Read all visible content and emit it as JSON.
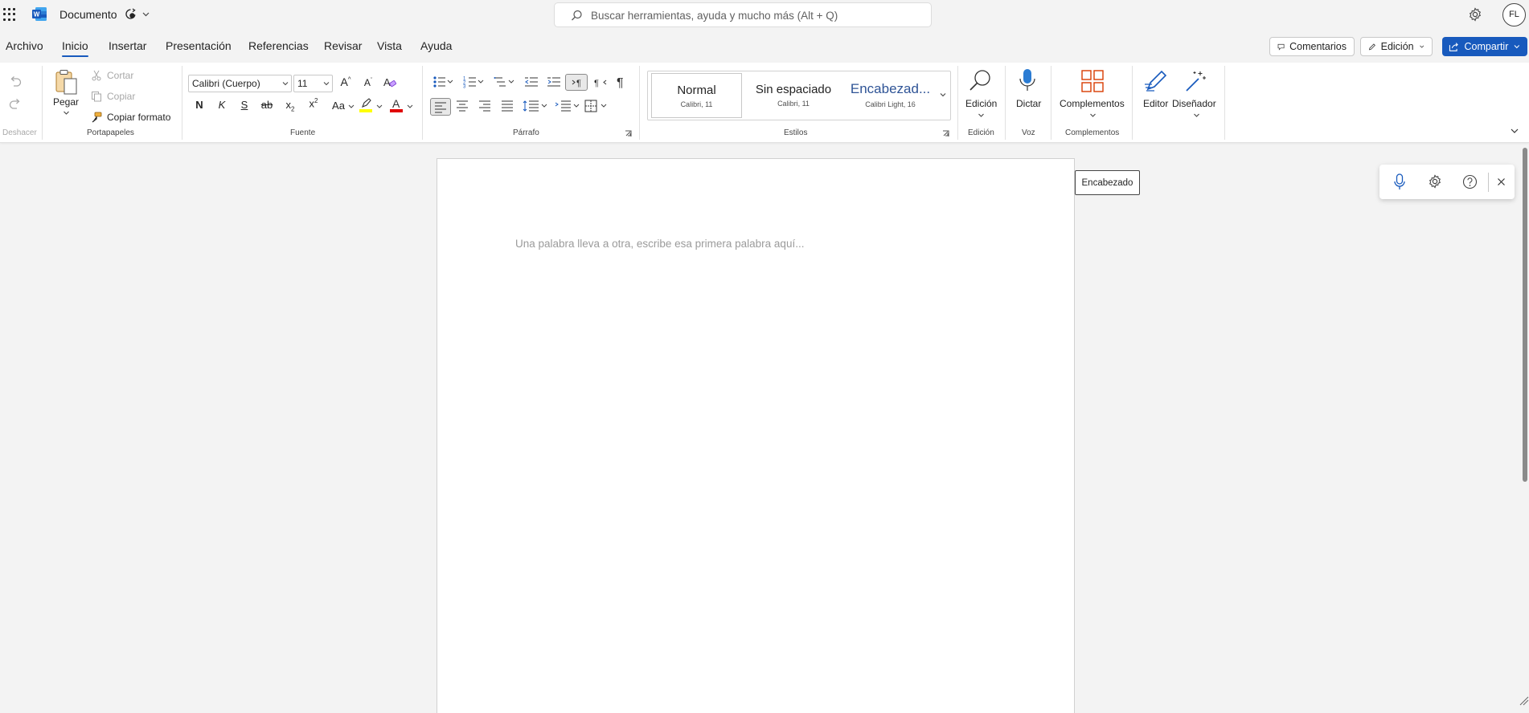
{
  "app": {
    "doc_name": "Documento",
    "search_placeholder": "Buscar herramientas, ayuda y mucho más (Alt + Q)",
    "avatar_initials": "FL"
  },
  "menu": {
    "tabs": [
      "Archivo",
      "Inicio",
      "Insertar",
      "Presentación",
      "Referencias",
      "Revisar",
      "Vista",
      "Ayuda"
    ],
    "active": "Inicio",
    "comments_label": "Comentarios",
    "editing_label": "Edición",
    "share_label": "Compartir"
  },
  "ribbon": {
    "undo_group_label": "Deshacer",
    "clipboard": {
      "paste_label": "Pegar",
      "cut_label": "Cortar",
      "copy_label": "Copiar",
      "format_painter_label": "Copiar formato",
      "group_label": "Portapapeles"
    },
    "font": {
      "font_name": "Calibri (Cuerpo)",
      "font_size": "11",
      "bold": "N",
      "italic": "K",
      "underline": "S",
      "strike": "ab",
      "change_case": "Aa",
      "grow": "A",
      "shrink": "A",
      "font_color_letter": "A",
      "group_label": "Fuente"
    },
    "paragraph": {
      "group_label": "Párrafo"
    },
    "styles": {
      "items": [
        {
          "name": "Normal",
          "sub": "Calibri, 11"
        },
        {
          "name": "Sin espaciado",
          "sub": "Calibri, 11"
        },
        {
          "name": "Encabezad...",
          "sub": "Calibri Light, 16"
        }
      ],
      "group_label": "Estilos"
    },
    "editing": {
      "label": "Edición",
      "group_label": "Edición"
    },
    "voice": {
      "label": "Dictar",
      "group_label": "Voz"
    },
    "addins": {
      "label": "Complementos",
      "group_label": "Complementos"
    },
    "editor_label": "Editor",
    "designer_label": "Diseñador"
  },
  "document": {
    "placeholder": "Una palabra lleva a otra, escribe esa primera palabra aquí..."
  },
  "tooltip": "Encabezado",
  "colors": {
    "accent": "#185abd",
    "highlight": "#ffff00",
    "font_color": "#e00000",
    "addins": "#d83b01"
  }
}
